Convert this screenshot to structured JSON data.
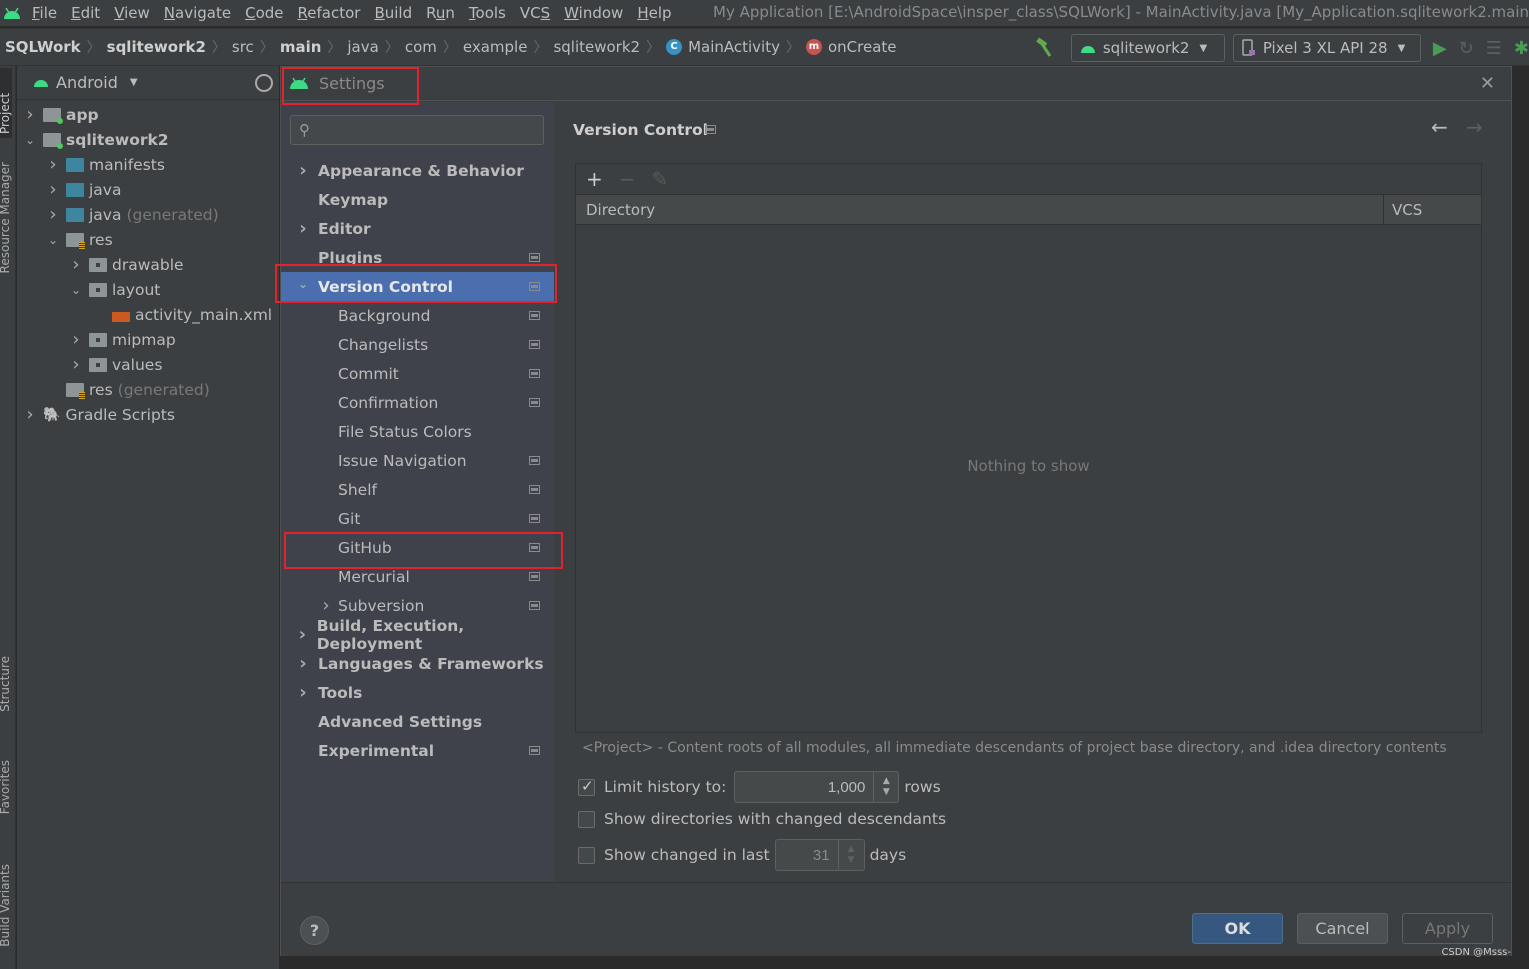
{
  "menubar": {
    "items": [
      "File",
      "Edit",
      "View",
      "Navigate",
      "Code",
      "Refactor",
      "Build",
      "Run",
      "Tools",
      "VCS",
      "Window",
      "Help"
    ],
    "mnemonics": [
      "F",
      "E",
      "V",
      "N",
      "C",
      "R",
      "B",
      "u",
      "T",
      "S",
      "W",
      "H"
    ],
    "window_title": "My Application [E:\\AndroidSpace\\insper_class\\SQLWork] - MainActivity.java [My_Application.sqlitework2.main]"
  },
  "navbar": {
    "breadcrumbs": [
      "SQLWork",
      "sqlitework2",
      "src",
      "main",
      "java",
      "com",
      "example",
      "sqlitework2",
      "MainActivity",
      "onCreate"
    ],
    "run_config": "sqlitework2",
    "device": "Pixel 3 XL API 28",
    "colors": {
      "class_icon": "#3592c4",
      "method_icon": "#c75450",
      "run": "#499c54",
      "build": "#5faa4a"
    }
  },
  "tool_stripe": {
    "left_tabs": [
      "Project",
      "Resource Manager",
      "Structure",
      "Favorites",
      "Build Variants"
    ]
  },
  "project_panel": {
    "view": "Android",
    "tree": [
      {
        "label": "app",
        "muted": "",
        "level": 0,
        "arrow": "right",
        "icon": "module",
        "bold": true
      },
      {
        "label": "sqlitework2",
        "muted": "",
        "level": 0,
        "arrow": "down",
        "icon": "module",
        "bold": true
      },
      {
        "label": "manifests",
        "muted": "",
        "level": 1,
        "arrow": "right",
        "icon": "blue"
      },
      {
        "label": "java",
        "muted": "",
        "level": 1,
        "arrow": "right",
        "icon": "blue"
      },
      {
        "label": "java",
        "muted": "(generated)",
        "level": 1,
        "arrow": "right",
        "icon": "blue"
      },
      {
        "label": "res",
        "muted": "",
        "level": 1,
        "arrow": "down",
        "icon": "res"
      },
      {
        "label": "drawable",
        "muted": "",
        "level": 2,
        "arrow": "right",
        "icon": "gray"
      },
      {
        "label": "layout",
        "muted": "",
        "level": 2,
        "arrow": "down",
        "icon": "gray"
      },
      {
        "label": "activity_main.xml",
        "muted": "",
        "level": 3,
        "arrow": "",
        "icon": "xml"
      },
      {
        "label": "mipmap",
        "muted": "",
        "level": 2,
        "arrow": "right",
        "icon": "gray"
      },
      {
        "label": "values",
        "muted": "",
        "level": 2,
        "arrow": "right",
        "icon": "gray"
      },
      {
        "label": "res",
        "muted": "(generated)",
        "level": 1,
        "arrow": "",
        "icon": "res"
      },
      {
        "label": "Gradle Scripts",
        "muted": "",
        "level": 0,
        "arrow": "right",
        "icon": "gradle"
      }
    ]
  },
  "settings": {
    "title": "Settings",
    "search_placeholder": "",
    "nav": [
      {
        "label": "Appearance & Behavior",
        "kind": "top",
        "arrow": "right",
        "project": false
      },
      {
        "label": "Keymap",
        "kind": "top",
        "arrow": "",
        "project": false
      },
      {
        "label": "Editor",
        "kind": "top",
        "arrow": "right",
        "project": false
      },
      {
        "label": "Plugins",
        "kind": "top",
        "arrow": "",
        "project": true
      },
      {
        "label": "Version Control",
        "kind": "top",
        "arrow": "down",
        "project": true,
        "selected": true
      },
      {
        "label": "Background",
        "kind": "sub",
        "arrow": "",
        "project": true
      },
      {
        "label": "Changelists",
        "kind": "sub",
        "arrow": "",
        "project": true
      },
      {
        "label": "Commit",
        "kind": "sub",
        "arrow": "",
        "project": true
      },
      {
        "label": "Confirmation",
        "kind": "sub",
        "arrow": "",
        "project": true
      },
      {
        "label": "File Status Colors",
        "kind": "sub",
        "arrow": "",
        "project": false
      },
      {
        "label": "Issue Navigation",
        "kind": "sub",
        "arrow": "",
        "project": true
      },
      {
        "label": "Shelf",
        "kind": "sub",
        "arrow": "",
        "project": true
      },
      {
        "label": "Git",
        "kind": "sub",
        "arrow": "",
        "project": true
      },
      {
        "label": "GitHub",
        "kind": "sub",
        "arrow": "",
        "project": true
      },
      {
        "label": "Mercurial",
        "kind": "sub",
        "arrow": "",
        "project": true
      },
      {
        "label": "Subversion",
        "kind": "sub2",
        "arrow": "right",
        "project": true
      },
      {
        "label": "Build, Execution, Deployment",
        "kind": "top",
        "arrow": "right",
        "project": false
      },
      {
        "label": "Languages & Frameworks",
        "kind": "top",
        "arrow": "right",
        "project": false
      },
      {
        "label": "Tools",
        "kind": "top",
        "arrow": "right",
        "project": false
      },
      {
        "label": "Advanced Settings",
        "kind": "top",
        "arrow": "",
        "project": false
      },
      {
        "label": "Experimental",
        "kind": "top",
        "arrow": "",
        "project": true
      }
    ],
    "page": {
      "title": "Version Control",
      "table": {
        "columns": [
          "Directory",
          "VCS"
        ],
        "rows": [],
        "empty_text": "Nothing to show"
      },
      "hint": "<Project> - Content roots of all modules, all immediate descendants of project base directory, and .idea directory contents",
      "limit_history": {
        "label": "Limit history to:",
        "checked": true,
        "value": "1,000",
        "unit": "rows"
      },
      "show_dirs": {
        "label": "Show directories with changed descendants",
        "checked": false
      },
      "show_changed": {
        "label": "Show changed in last",
        "checked": false,
        "value": "31",
        "unit": "days"
      }
    },
    "buttons": {
      "ok": "OK",
      "cancel": "Cancel",
      "apply": "Apply",
      "help": "?"
    },
    "accent": "#4b6eaf",
    "highlight_color": "#e0232d"
  },
  "watermark": "CSDN @Msss-"
}
